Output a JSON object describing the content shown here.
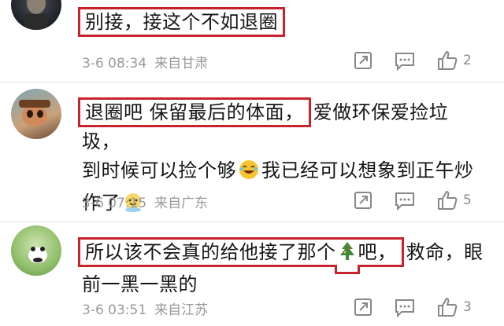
{
  "comments": [
    {
      "text_highlight": "别接，接这个不如退圈",
      "text_rest": "",
      "time": "3-6 08:34",
      "location": "来自甘肃",
      "likes": "2"
    },
    {
      "text_highlight": "退圈吧  保留最后的体面，",
      "text_rest_1": "爱做环保爱捡垃圾，",
      "text_rest_2": "到时候可以捡个够",
      "text_rest_3": "我已经可以想象到正午炒",
      "text_rest_4": "作了",
      "time": "3-6 07:15",
      "location": "来自广东",
      "likes": "5"
    },
    {
      "text_highlight": "所以该不会真的给他接了那个",
      "text_hl_end": "吧，",
      "text_rest_1": "救命，眼",
      "text_rest_2": "前一黑一黑的",
      "time": "3-6 03:51",
      "location": "来自江苏",
      "likes": "3"
    }
  ],
  "icons": {
    "share": "share-icon",
    "reply": "comment-icon",
    "like": "thumbs-up-icon",
    "emoji_laugh": "laughing-emoji",
    "emoji_smile": "smiling-emoji",
    "emoji_tree": "christmas-tree-emoji"
  },
  "colors": {
    "highlight_box": "#c8232c",
    "meta_text": "#9a9a9a"
  }
}
